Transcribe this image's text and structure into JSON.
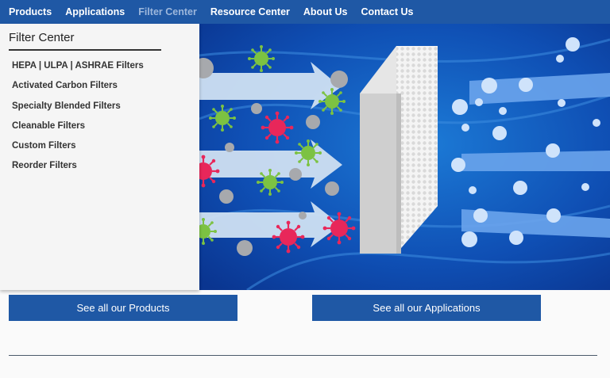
{
  "nav": {
    "items": [
      {
        "label": "Products",
        "active": false
      },
      {
        "label": "Applications",
        "active": false
      },
      {
        "label": "Filter Center",
        "active": true
      },
      {
        "label": "Resource Center",
        "active": false
      },
      {
        "label": "About Us",
        "active": false
      },
      {
        "label": "Contact Us",
        "active": false
      }
    ]
  },
  "dropdown": {
    "title": "Filter Center",
    "items": [
      "HEPA | ULPA | ASHRAE Filters",
      "Activated Carbon Filters",
      "Specialty Blended Filters",
      "Cleanable Filters",
      "Custom Filters",
      "Reorder Filters"
    ]
  },
  "buttons": {
    "products": "See all our Products",
    "applications": "See all our Applications"
  },
  "colors": {
    "brand_blue": "#1f58a5",
    "nav_active": "#9db7dc",
    "dropdown_bg": "#f5f5f5"
  }
}
